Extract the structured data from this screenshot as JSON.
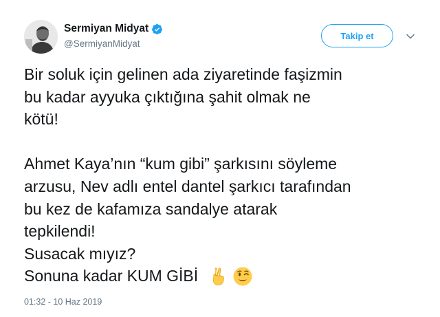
{
  "user": {
    "display_name": "Sermiyan Midyat",
    "handle": "@SermiyanMidyat",
    "verified": true,
    "verified_icon": "verified-badge-icon",
    "avatar_icon": "user-avatar"
  },
  "follow_button": {
    "label": "Takip et",
    "color": "#1da1f2"
  },
  "menu_icon": "chevron-down-icon",
  "tweet": {
    "lines": [
      "Bir soluk için gelinen ada ziyaretinde faşizmin",
      "bu kadar ayyuka çıktığına şahit olmak ne",
      "kötü!",
      "",
      "Ahmet Kaya’nın “kum gibi” şarkısını söyleme",
      "arzusu, Nev adlı entel dantel şarkıcı tarafından",
      "bu kez de kafamıza sandalye atarak",
      "tepkilendi!",
      "Susacak mıyız?",
      "Sonuna kadar KUM GİBİ"
    ],
    "emojis": [
      "victory-hand-icon",
      "winking-face-icon"
    ]
  },
  "timestamp": "01:32 - 10 Haz 2019",
  "colors": {
    "text": "#14171a",
    "secondary": "#657786",
    "accent": "#1da1f2"
  }
}
